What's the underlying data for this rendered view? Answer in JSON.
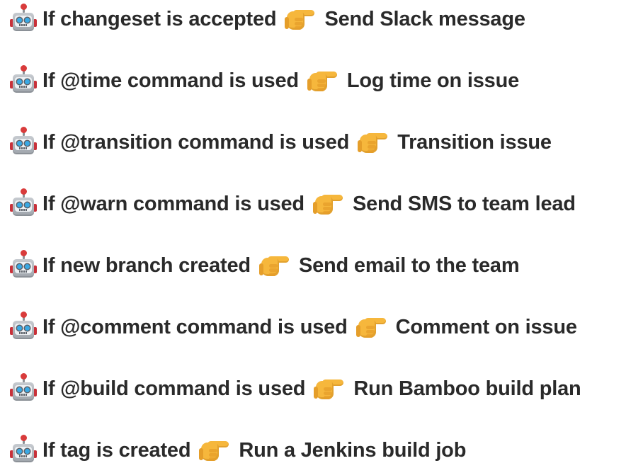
{
  "rules": [
    {
      "robot_icon": "robot-icon",
      "condition": "If changeset is accepted",
      "arrow_icon": "pointing-right-hand-icon",
      "action": "Send Slack message"
    },
    {
      "robot_icon": "robot-icon",
      "condition": "If @time command is used",
      "arrow_icon": "pointing-right-hand-icon",
      "action": "Log time on issue"
    },
    {
      "robot_icon": "robot-icon",
      "condition": "If @transition command is used",
      "arrow_icon": "pointing-right-hand-icon",
      "action": "Transition issue"
    },
    {
      "robot_icon": "robot-icon",
      "condition": "If @warn command is used",
      "arrow_icon": "pointing-right-hand-icon",
      "action": "Send SMS to team lead"
    },
    {
      "robot_icon": "robot-icon",
      "condition": "If new branch created",
      "arrow_icon": "pointing-right-hand-icon",
      "action": "Send email to the team"
    },
    {
      "robot_icon": "robot-icon",
      "condition": "If @comment command is used",
      "arrow_icon": "pointing-right-hand-icon",
      "action": "Comment on issue"
    },
    {
      "robot_icon": "robot-icon",
      "condition": "If @build command is used",
      "arrow_icon": "pointing-right-hand-icon",
      "action": "Run Bamboo build plan"
    },
    {
      "robot_icon": "robot-icon",
      "condition": "If tag is created",
      "arrow_icon": "pointing-right-hand-icon",
      "action": "Run a Jenkins build job"
    }
  ],
  "colors": {
    "text": "#2a2a2a",
    "background": "#ffffff",
    "robot_body": "#9ea4ab",
    "robot_accent": "#c8313a",
    "hand": "#f6b73c"
  }
}
